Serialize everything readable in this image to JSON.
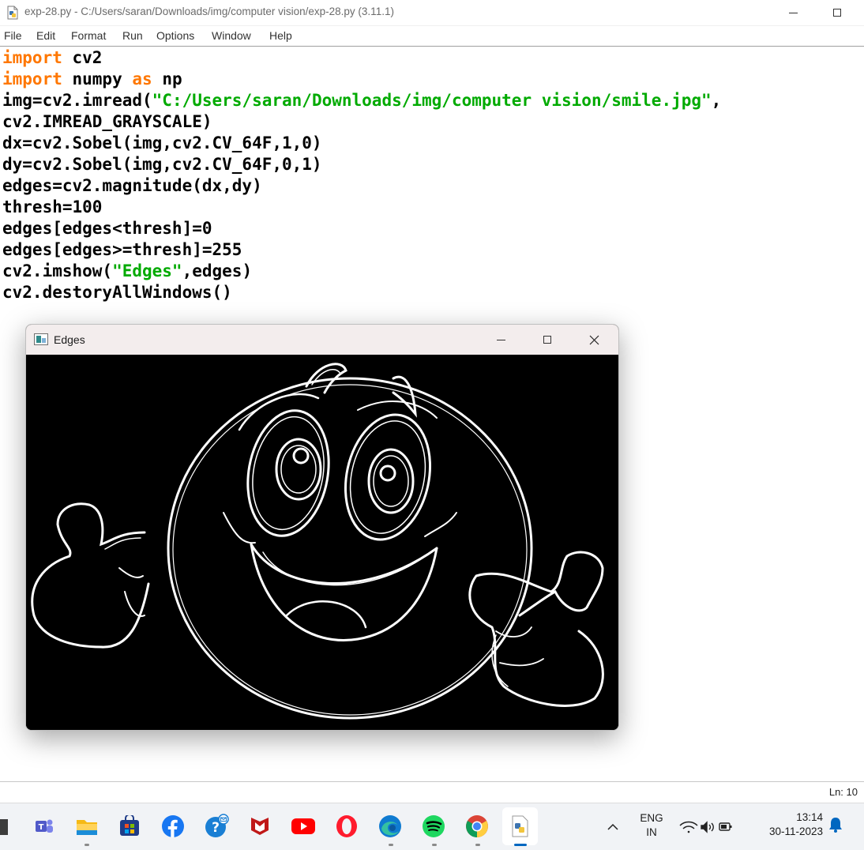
{
  "window": {
    "title": "exp-28.py - C:/Users/saran/Downloads/img/computer vision/exp-28.py (3.11.1)"
  },
  "menu": {
    "items": [
      "File",
      "Edit",
      "Format",
      "Run",
      "Options",
      "Window",
      "Help"
    ]
  },
  "code": {
    "lines": [
      [
        {
          "t": "import",
          "k": "kw"
        },
        {
          "t": " cv2",
          "k": "plain"
        }
      ],
      [
        {
          "t": "import",
          "k": "kw"
        },
        {
          "t": " numpy ",
          "k": "plain"
        },
        {
          "t": "as",
          "k": "kw"
        },
        {
          "t": " np",
          "k": "plain"
        }
      ],
      [
        {
          "t": "img=cv2.imread(",
          "k": "plain"
        },
        {
          "t": "\"C:/Users/saran/Downloads/img/computer vision/smile.jpg\"",
          "k": "str"
        },
        {
          "t": ",",
          "k": "plain"
        }
      ],
      [
        {
          "t": "cv2.IMREAD_GRAYSCALE)",
          "k": "plain"
        }
      ],
      [
        {
          "t": "dx=cv2.Sobel(img,cv2.CV_64F,1,0)",
          "k": "plain"
        }
      ],
      [
        {
          "t": "dy=cv2.Sobel(img,cv2.CV_64F,0,1)",
          "k": "plain"
        }
      ],
      [
        {
          "t": "edges=cv2.magnitude(dx,dy)",
          "k": "plain"
        }
      ],
      [
        {
          "t": "thresh=100",
          "k": "plain"
        }
      ],
      [
        {
          "t": "edges[edges<thresh]=0",
          "k": "plain"
        }
      ],
      [
        {
          "t": "edges[edges>=thresh]=255",
          "k": "plain"
        }
      ],
      [
        {
          "t": "cv2.imshow(",
          "k": "plain"
        },
        {
          "t": "\"Edges\"",
          "k": "str"
        },
        {
          "t": ",edges)",
          "k": "plain"
        }
      ],
      [
        {
          "t": "cv2.destoryAllWindows()",
          "k": "plain"
        }
      ]
    ]
  },
  "edges_window": {
    "title": "Edges"
  },
  "statusbar": {
    "line": "Ln: 10"
  },
  "taskbar": {
    "language": "ENG",
    "region": "IN",
    "time": "13:14",
    "date": "30-11-2023",
    "apps": [
      "teams-icon",
      "file-explorer-icon",
      "microsoft-store-icon",
      "facebook-icon",
      "get-help-icon",
      "mcafee-icon",
      "youtube-icon",
      "opera-icon",
      "edge-icon",
      "spotify-icon",
      "chrome-icon",
      "python-idle-icon"
    ]
  },
  "colors": {
    "keyword": "#ff7700",
    "string": "#00aa00",
    "taskbar_accent": "#0067c0"
  }
}
